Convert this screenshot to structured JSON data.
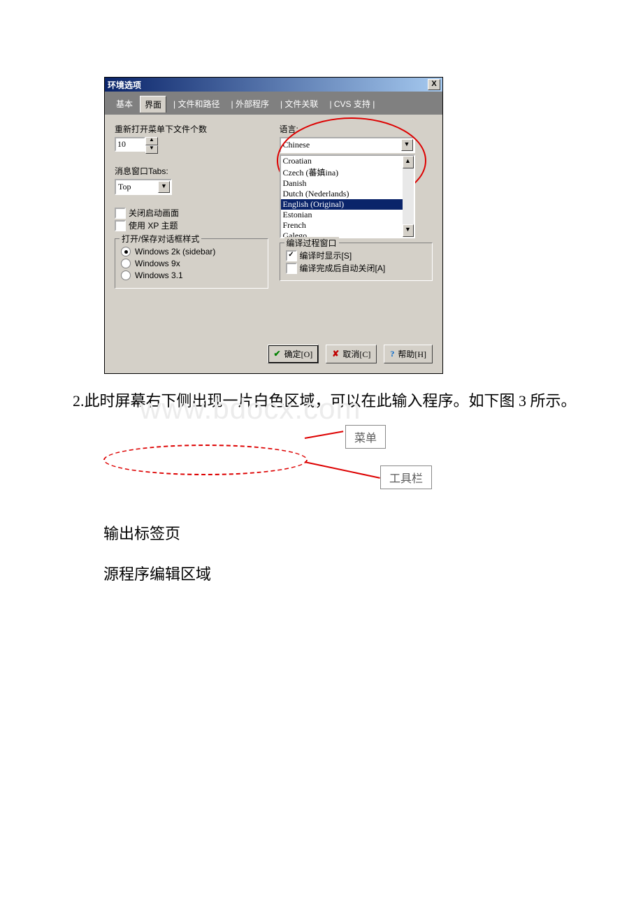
{
  "dialog": {
    "title": "环境选项",
    "close": "X",
    "tabs": {
      "basic": "基本",
      "ui": "界面",
      "paths": "文件和路径",
      "ext": "外部程序",
      "assoc": "文件关联",
      "cvs": "CVS 支持"
    },
    "reopen": {
      "label": "重新打开菜单下文件个数",
      "value": "10"
    },
    "msgtabs": {
      "label": "消息窗口Tabs:",
      "value": "Top"
    },
    "splash": "关闭启动画面",
    "xptheme": "使用 XP 主题",
    "dlgstyle": {
      "legend": "打开/保存对话框样式",
      "opt2k": "Windows 2k (sidebar)",
      "opt9x": "Windows 9x",
      "opt31": "Windows 3.1"
    },
    "lang": {
      "label": "语言:",
      "selected": "Chinese",
      "items": {
        "i0": "Croatian",
        "i1": "Czech (蕃嫃ina)",
        "i2": "Danish",
        "i3": "Dutch (Nederlands)",
        "i4": "English (Original)",
        "i5": "Estonian",
        "i6": "French",
        "i7": "Galego"
      }
    },
    "compile": {
      "legend": "编译过程窗口",
      "show": "编译时显示[S]",
      "close": "编译完成后自动关闭[A]"
    },
    "buttons": {
      "ok": "确定[O]",
      "cancel": "取消[C]",
      "help": "帮助[H]"
    }
  },
  "paragraph": {
    "prefix": "2.",
    "text": "此时屏幕右下侧出现一片白色区域，可以在此输入程序。如下图 3 所示。",
    "watermark": "www.bdocx.com"
  },
  "diagram": {
    "menu": "菜单",
    "toolbar": "工具栏"
  },
  "section": {
    "out": "输出标签页",
    "edit": "源程序编辑区域"
  }
}
